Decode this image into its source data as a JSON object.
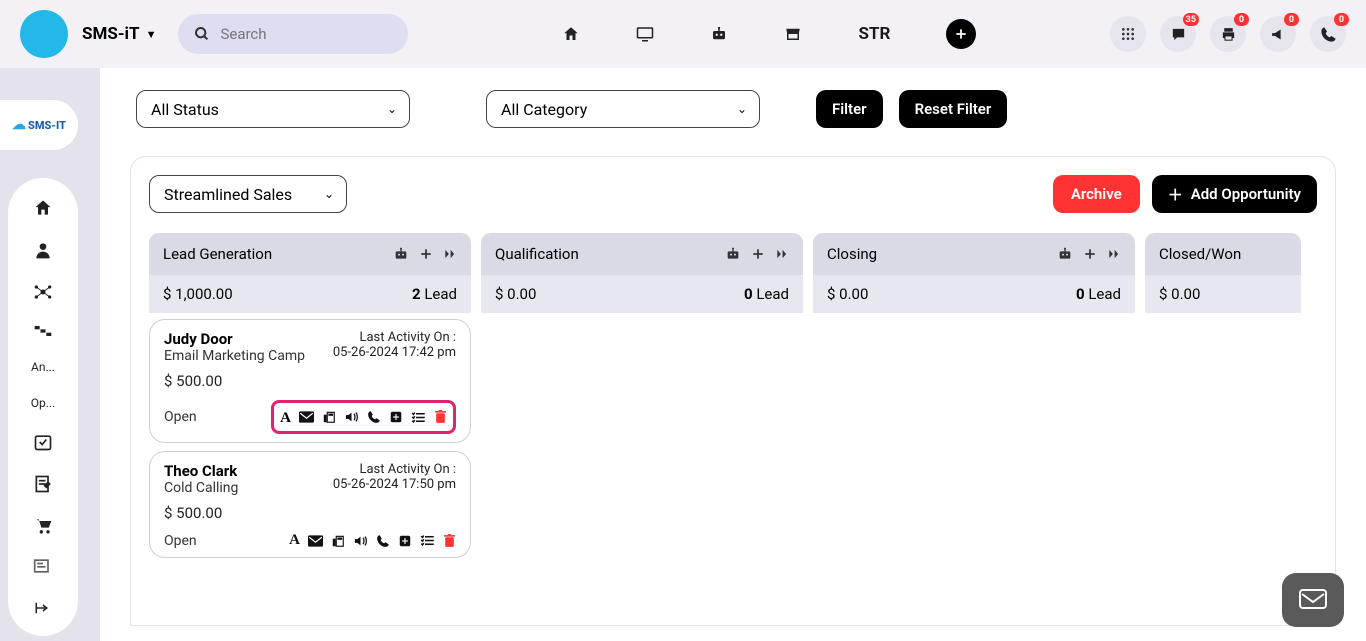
{
  "header": {
    "brand": "SMS-iT",
    "search_placeholder": "Search",
    "str_label": "STR",
    "badges": {
      "chat": "35",
      "print": "0",
      "announce": "0",
      "phone": "0"
    }
  },
  "sidebar": {
    "items": [
      {
        "label": "An..."
      },
      {
        "label": "Op..."
      }
    ]
  },
  "filters": {
    "status": "All Status",
    "category": "All Category",
    "filter_btn": "Filter",
    "reset_btn": "Reset Filter"
  },
  "board": {
    "pipeline": "Streamlined Sales ",
    "archive_btn": "Archive",
    "add_btn": "Add Opportunity"
  },
  "columns": [
    {
      "title": "Lead Generation",
      "amount": "$ 1,000.00",
      "count": "2",
      "count_label": " Lead",
      "cards": [
        {
          "name": "Judy Door",
          "campaign": "Email Marketing Camp",
          "activity_label": "Last Activity On :",
          "activity_time": "05-26-2024 17:42 pm",
          "amount": "$ 500.00",
          "status": "Open",
          "highlighted": true
        },
        {
          "name": "Theo Clark",
          "campaign": "Cold Calling",
          "activity_label": "Last Activity On :",
          "activity_time": "05-26-2024 17:50 pm",
          "amount": "$ 500.00",
          "status": "Open",
          "highlighted": false
        }
      ]
    },
    {
      "title": "Qualification",
      "amount": "$ 0.00",
      "count": "0",
      "count_label": " Lead",
      "cards": []
    },
    {
      "title": "Closing",
      "amount": "$ 0.00",
      "count": "0",
      "count_label": " Lead",
      "cards": []
    },
    {
      "title": "Closed/Won",
      "amount": "$ 0.00",
      "count": "",
      "count_label": "",
      "cards": [],
      "narrow": true
    }
  ],
  "logo_text": "SMS-IT"
}
